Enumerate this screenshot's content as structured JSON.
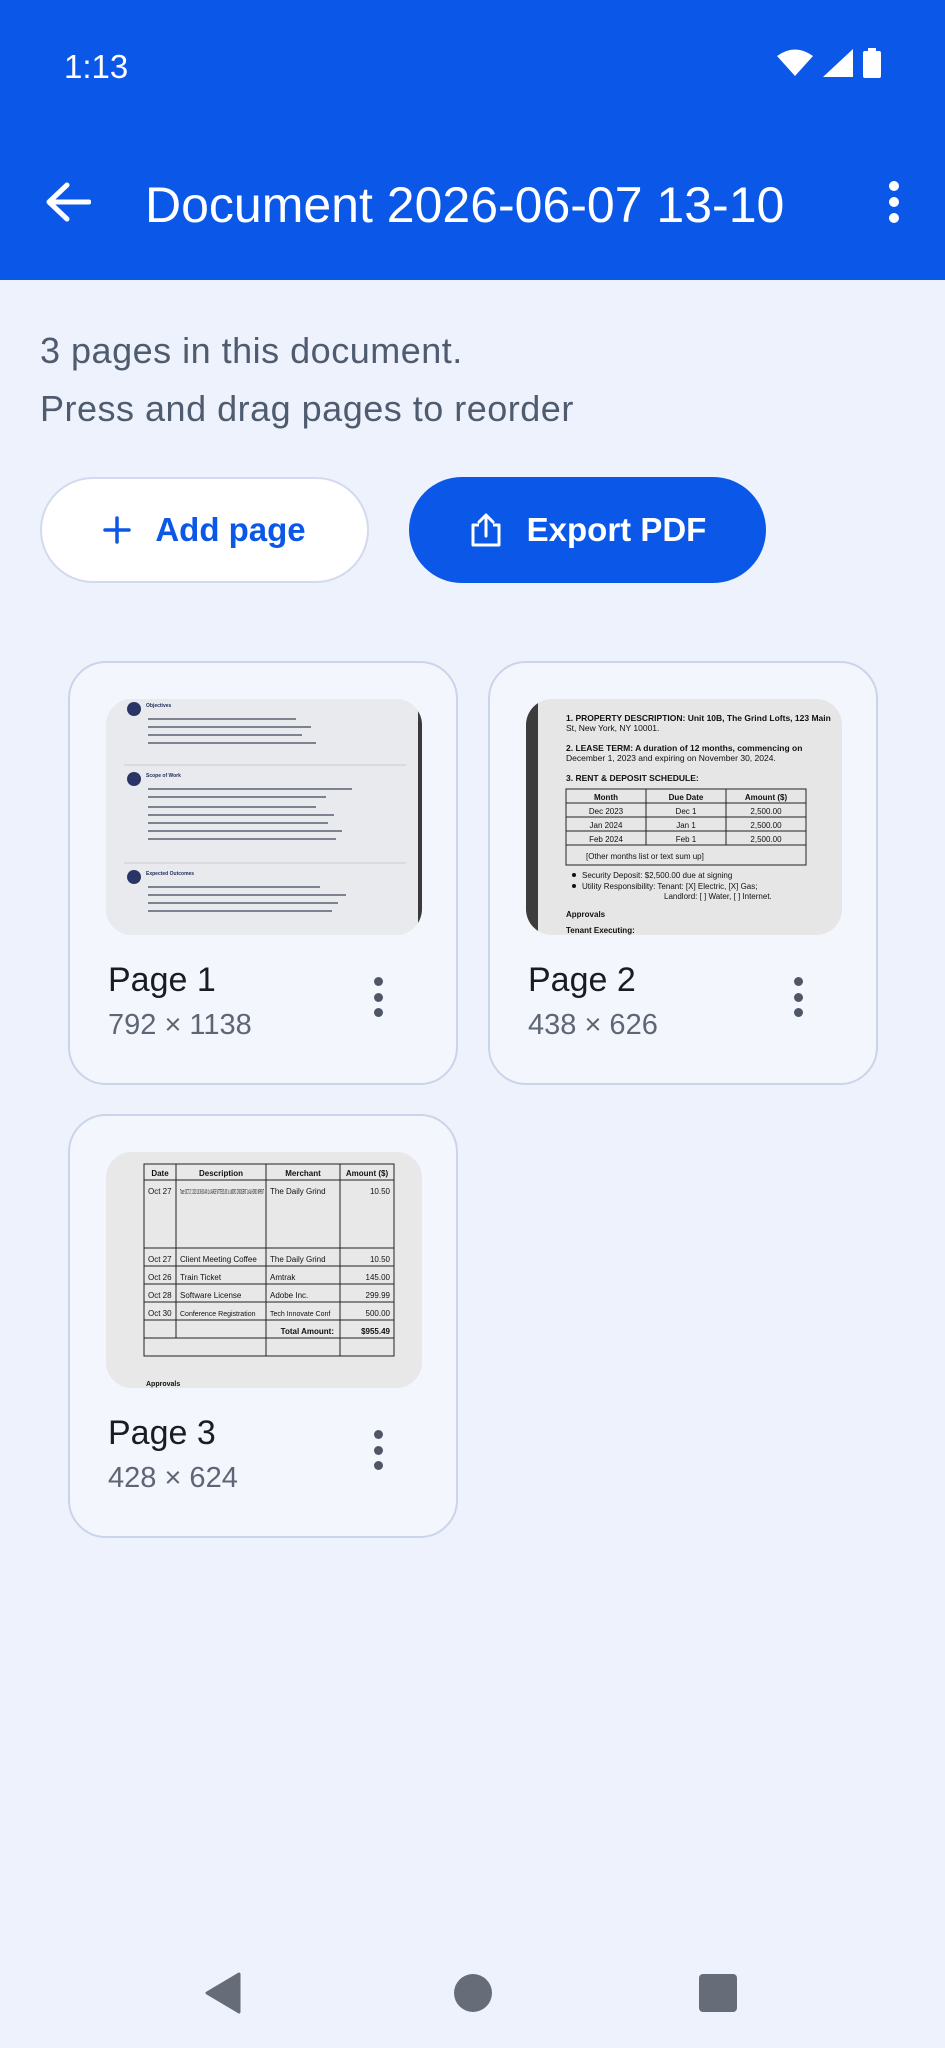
{
  "status_bar": {
    "time": "1:13"
  },
  "app_bar": {
    "title": "Document 2026-06-07 13-10"
  },
  "info": {
    "line1": "3 pages in this document.",
    "line2": "Press and drag pages to reorder"
  },
  "actions": {
    "add_page": "Add page",
    "export_pdf": "Export PDF"
  },
  "pages": [
    {
      "label": "Page 1",
      "dims": "792 × 1138"
    },
    {
      "label": "Page 2",
      "dims": "438 × 626"
    },
    {
      "label": "Page 3",
      "dims": "428 × 624"
    }
  ],
  "thumb_text": {
    "p1": [
      "Objectives",
      "Scope of Work",
      "Expected Outcomes"
    ],
    "p2": {
      "lines": [
        "1. PROPERTY DESCRIPTION: Unit 10B, The Grind Lofts, 123 Main",
        "St, New York, NY 10001.",
        "2. LEASE TERM: A duration of 12 months, commencing on",
        "December 1, 2023 and expiring on November 30, 2024.",
        "3. RENT & DEPOSIT SCHEDULE:"
      ],
      "headers": [
        "Month",
        "Due Date",
        "Amount ($)"
      ],
      "rows": [
        [
          "Dec 2023",
          "Dec 1",
          "2,500.00"
        ],
        [
          "Jan 2024",
          "Jan 1",
          "2,500.00"
        ],
        [
          "Feb 2024",
          "Feb 1",
          "2,500.00"
        ]
      ],
      "other_months": "[Other months list or text sum up]",
      "bullets": [
        "Security Deposit: $2,500.00 due at signing",
        "Utility Responsibility: Tenant: [X] Electric, [X] Gas;",
        "Landlord: [ ] Water, [ ] Internet."
      ],
      "approvals": "Approvals",
      "tenant_executing": "Tenant Executing:"
    },
    "p3": {
      "headers": [
        "Date",
        "Description",
        "Merchant",
        "Amount ($)"
      ],
      "rows": [
        [
          "Oct 27",
          "Trace OCT 27, 2023 10:30-30 AM 1x LARGE WTTE $5.50 1x LMORC CROIGENT 1x ALHORD INPENT",
          "The Daily Grind",
          "10.50"
        ],
        [
          "Oct 27",
          "Client Meeting Coffee",
          "The Daily Grind",
          "10.50"
        ],
        [
          "Oct 26",
          "Train Ticket",
          "Amtrak",
          "145.00"
        ],
        [
          "Oct 28",
          "Software License",
          "Adobe Inc.",
          "299.99"
        ],
        [
          "Oct 30",
          "Conference Registration",
          "Tech Innovate Conf",
          "500.00"
        ]
      ],
      "total_label": "Total Amount:",
      "total_value": "$955.49",
      "approvals": "Approvals"
    }
  },
  "colors": {
    "primary": "#0B57E8",
    "background": "#EEF2FC",
    "card_border": "#CAD4EA"
  },
  "icons": [
    "wifi-icon",
    "signal-icon",
    "battery-icon",
    "arrow-back-icon",
    "more-vert-icon",
    "plus-icon",
    "share-icon"
  ]
}
